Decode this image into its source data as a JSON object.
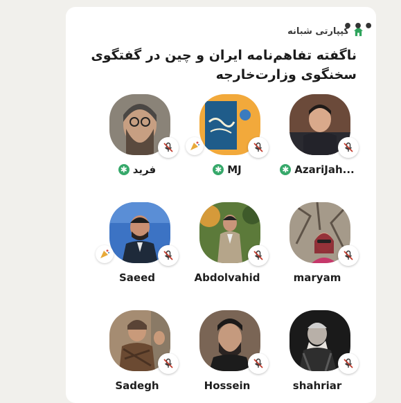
{
  "club": {
    "name": "کپپارتی شبانه",
    "icon": "house-icon",
    "accent": "#2ea45c"
  },
  "menu": {
    "label": "•••"
  },
  "room": {
    "title": "ناگفته تفاهم‌نامه ایران و چین در گفتگوی سخنگوی وزارت‌خارجه"
  },
  "colors": {
    "moderator": "#36a86a",
    "mic_muted": "#c0392b"
  },
  "speakers": [
    {
      "name": "AzariJah...",
      "moderator": true,
      "badge": false
    },
    {
      "name": "MJ",
      "moderator": true,
      "badge": true
    },
    {
      "name": "فرید",
      "moderator": true,
      "badge": false
    },
    {
      "name": "maryam",
      "moderator": false,
      "badge": false
    },
    {
      "name": "Abdolvahid",
      "moderator": false,
      "badge": false
    },
    {
      "name": "Saeed",
      "moderator": false,
      "badge": true
    },
    {
      "name": "shahriar",
      "moderator": false,
      "badge": false
    },
    {
      "name": "Hossein",
      "moderator": false,
      "badge": false
    },
    {
      "name": "Sadegh",
      "moderator": false,
      "badge": false
    }
  ]
}
